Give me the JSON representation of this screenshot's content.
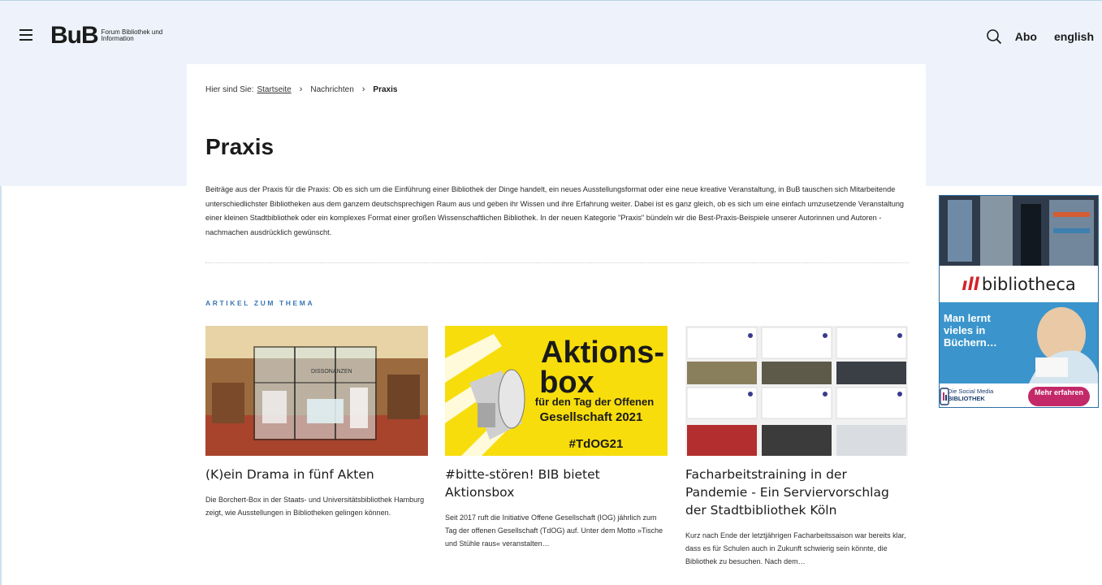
{
  "header": {
    "logo_mark": "BuB",
    "logo_sub": "Forum Bibliothek und Information",
    "abo_label": "Abo",
    "english_label": "english"
  },
  "breadcrumb": {
    "prefix": "Hier sind Sie:",
    "home": "Startseite",
    "parent": "Nachrichten",
    "current": "Praxis",
    "separator": "›"
  },
  "page": {
    "title": "Praxis",
    "intro": "Beiträge aus der Praxis für die Praxis: Ob es sich um die Einführung einer Bibliothek der Dinge handelt, ein neues Ausstellungsformat oder eine neue kreative Veranstaltung, in BuB tauschen sich Mitarbeitende unterschiedlichster Bibliotheken aus dem ganzem deutschsprechigen Raum aus und geben ihr Wissen und ihre Erfahrung weiter. Dabei ist es ganz gleich, ob es sich um eine einfach umzusetzende Veranstaltung einer kleinen Stadtbibliothek oder ein komplexes Format einer großen Wissenschaftlichen Bibliothek. In der neuen Kategorie \"Praxis\" bündeln wir die Best-Praxis-Beispiele unserer Autorinnen und Autoren - nachmachen ausdrücklich gewünscht.",
    "section_label": "ARTIKEL ZUM THEMA"
  },
  "articles": [
    {
      "title": "(K)ein Drama in fünf Akten",
      "teaser": "Die Borchert-Box in der Staats- und Universitätsbibliothek Hamburg zeigt, wie Ausstellungen in Bibliotheken gelingen können.",
      "image_text": "DISSONANZEN"
    },
    {
      "title": "#bitte-stören! BIB bietet Aktionsbox",
      "teaser": "Seit 2017 ruft die Initiative Offene Gesellschaft (IOG) jährlich zum Tag der offenen Gesellschaft (TdOG) auf. Unter dem Motto »Tische und Stühle raus« veranstalten…",
      "image_line1": "Aktions-",
      "image_line2": "box",
      "image_line3": "für den Tag der Offenen",
      "image_line4": "Gesellschaft 2021",
      "image_line5": "#TdOG21"
    },
    {
      "title": "Facharbeitstraining in der Pandemie - Ein Serviervorschlag der Stadtbibliothek Köln",
      "teaser": "Kurz nach Ende der letztjährigen Facharbeitssaison war bereits klar, dass es für Schulen auch in Zukunft schwierig sein könnte, die Bibliothek zu besuchen. Nach dem…"
    }
  ],
  "ad": {
    "brand": "bibliotheca",
    "headline": "Man lernt vieles in Büchern…",
    "sm_line1": "Die Social Media",
    "sm_line2": "BIBLIOTHEK",
    "button": "Mehr erfahren"
  },
  "colors": {
    "hero_bg": "#eef3fb",
    "accent_blue": "#3a77b5",
    "ad_pink": "#c32969",
    "aktion_yellow": "#f7dd0b"
  }
}
